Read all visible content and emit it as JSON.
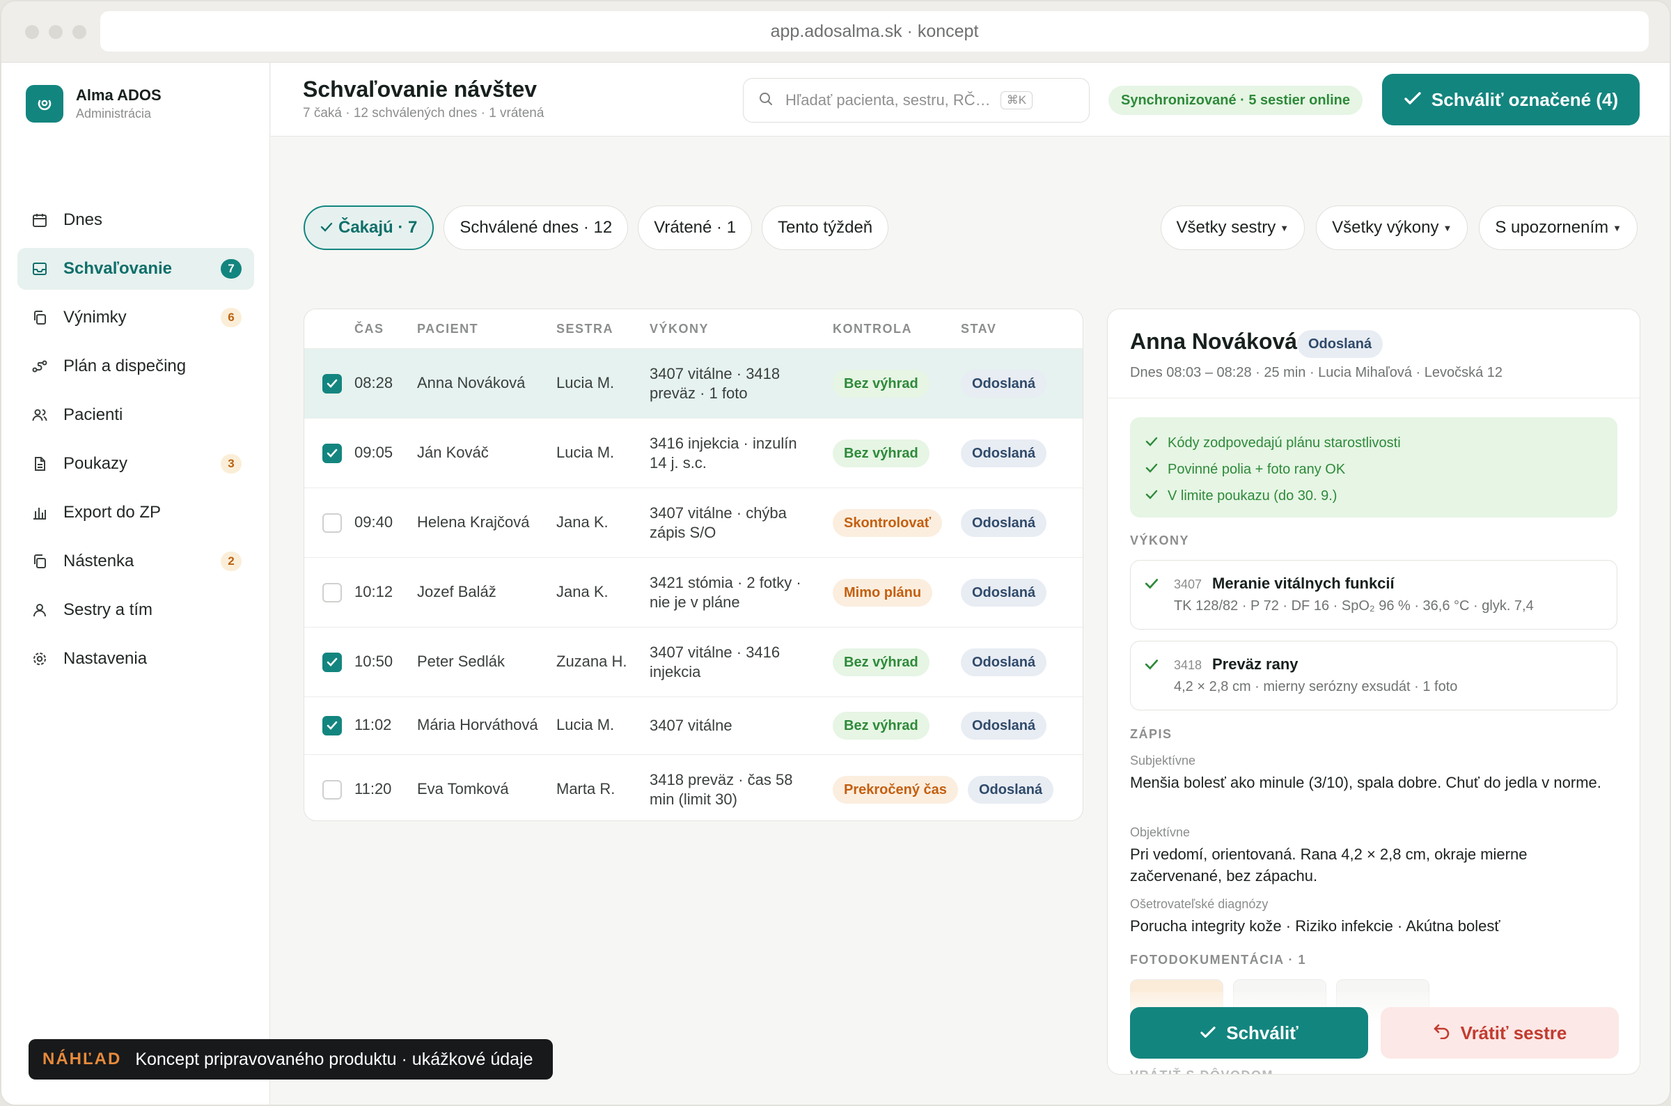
{
  "browser": {
    "url": "app.adosalma.sk · koncept"
  },
  "brand": {
    "name": "Alma ADOS",
    "subtitle": "Administrácia"
  },
  "sidebar": {
    "items": [
      {
        "label": "Dnes",
        "icon": "calendar-icon"
      },
      {
        "label": "Schvaľovanie",
        "icon": "inbox-icon",
        "badge": "7",
        "active": true
      },
      {
        "label": "Výnimky",
        "icon": "copy-icon",
        "badge": "6"
      },
      {
        "label": "Plán a dispečing",
        "icon": "route-icon"
      },
      {
        "label": "Pacienti",
        "icon": "users-icon"
      },
      {
        "label": "Poukazy",
        "icon": "document-icon",
        "badge": "3"
      },
      {
        "label": "Export do ZP",
        "icon": "bar-chart-icon"
      },
      {
        "label": "Nástenka",
        "icon": "copy-icon",
        "badge": "2"
      },
      {
        "label": "Sestry a tím",
        "icon": "user-icon"
      },
      {
        "label": "Nastavenia",
        "icon": "gear-icon"
      }
    ]
  },
  "preview_banner": {
    "tag": "NÁHĽAD",
    "text": "Koncept pripravovaného produktu · ukážkové údaje"
  },
  "header": {
    "title": "Schvaľovanie návštev",
    "subtitle": "7 čaká · 12 schválených dnes · 1 vrátená",
    "search_placeholder": "Hľadať pacienta, sestru, RČ…",
    "search_shortcut": "⌘K",
    "sync_status": "Synchronizované · 5 sestier online",
    "approve_selected": "Schváliť označené (4)"
  },
  "filters": {
    "tabs": [
      {
        "label": "Čakajú · 7",
        "active": true
      },
      {
        "label": "Schválené dnes · 12"
      },
      {
        "label": "Vrátené · 1"
      },
      {
        "label": "Tento týždeň"
      }
    ],
    "dropdowns": [
      {
        "label": "Všetky sestry"
      },
      {
        "label": "Všetky výkony"
      },
      {
        "label": "S upozornením"
      }
    ]
  },
  "table": {
    "columns": {
      "time": "ČAS",
      "patient": "PACIENT",
      "nurse": "SESTRA",
      "procedures": "VÝKONY",
      "check": "KONTROLA",
      "status": "STAV"
    },
    "rows": [
      {
        "checked": true,
        "selected": true,
        "time": "08:28",
        "patient": "Anna Nováková",
        "nurse": "Lucia M.",
        "procedures": "3407 vitálne · 3418 preväz · 1 foto",
        "check": "Bez výhrad",
        "check_type": "ok",
        "status": "Odoslaná"
      },
      {
        "checked": true,
        "time": "09:05",
        "patient": "Ján Kováč",
        "nurse": "Lucia M.",
        "procedures": "3416 injekcia · inzulín 14 j. s.c.",
        "check": "Bez výhrad",
        "check_type": "ok",
        "status": "Odoslaná"
      },
      {
        "checked": false,
        "time": "09:40",
        "patient": "Helena Krajčová",
        "nurse": "Jana K.",
        "procedures": "3407 vitálne · chýba zápis S/O",
        "check": "Skontrolovať",
        "check_type": "warn",
        "status": "Odoslaná"
      },
      {
        "checked": false,
        "time": "10:12",
        "patient": "Jozef Baláž",
        "nurse": "Jana K.",
        "procedures": "3421 stómia · 2 fotky · nie je v pláne",
        "check": "Mimo plánu",
        "check_type": "warn",
        "status": "Odoslaná"
      },
      {
        "checked": true,
        "time": "10:50",
        "patient": "Peter Sedlák",
        "nurse": "Zuzana H.",
        "procedures": "3407 vitálne · 3416 injekcia",
        "check": "Bez výhrad",
        "check_type": "ok",
        "status": "Odoslaná"
      },
      {
        "checked": true,
        "time": "11:02",
        "patient": "Mária Horváthová",
        "nurse": "Lucia M.",
        "procedures": "3407 vitálne",
        "check": "Bez výhrad",
        "check_type": "ok",
        "status": "Odoslaná"
      },
      {
        "checked": false,
        "time": "11:20",
        "patient": "Eva Tomková",
        "nurse": "Marta R.",
        "procedures": "3418 preväz · čas 58 min (limit 30)",
        "check": "Prekročený čas",
        "check_type": "warn",
        "status": "Odoslaná"
      }
    ]
  },
  "detail": {
    "name": "Anna Nováková",
    "status": "Odoslaná",
    "meta": "Dnes 08:03 – 08:28 · 25 min · Lucia Mihaľová · Levočská 12",
    "checks": [
      "Kódy zodpovedajú plánu starostlivosti",
      "Povinné polia + foto rany OK",
      "V limite poukazu (do 30. 9.)"
    ],
    "procedures_heading": "VÝKONY",
    "procedures": [
      {
        "code": "3407",
        "title": "Meranie vitálnych funkcií",
        "detail": "TK 128/82 · P 72 · DF 16 · SpO₂ 96 % · 36,6 °C · glyk. 7,4"
      },
      {
        "code": "3418",
        "title": "Preväz rany",
        "detail": "4,2 × 2,8 cm · mierny serózny exsudát · 1 foto"
      }
    ],
    "record_heading": "ZÁPIS",
    "subjective_label": "Subjektívne",
    "subjective": "Menšia bolesť ako minule (3/10), spala dobre. Chuť do jedla v norme.",
    "objective_label": "Objektívne",
    "objective": "Pri vedomí, orientovaná. Rana 4,2 × 2,8 cm, okraje mierne začervenané, bez zápachu.",
    "diagnoses_label": "Ošetrovateľské diagnózy",
    "diagnoses": "Porucha integrity kože · Riziko infekcie · Akútna bolesť",
    "photos_heading": "FOTODOKUMENTÁCIA · 1",
    "next_heading": "VRÁTIŤ S DÔVODOM",
    "approve": "Schváliť",
    "return": "Vrátiť sestre"
  },
  "colors": {
    "accent": "#13857f",
    "ok": "#2e8a3a",
    "warn": "#c45f10",
    "danger": "#c23b30"
  }
}
